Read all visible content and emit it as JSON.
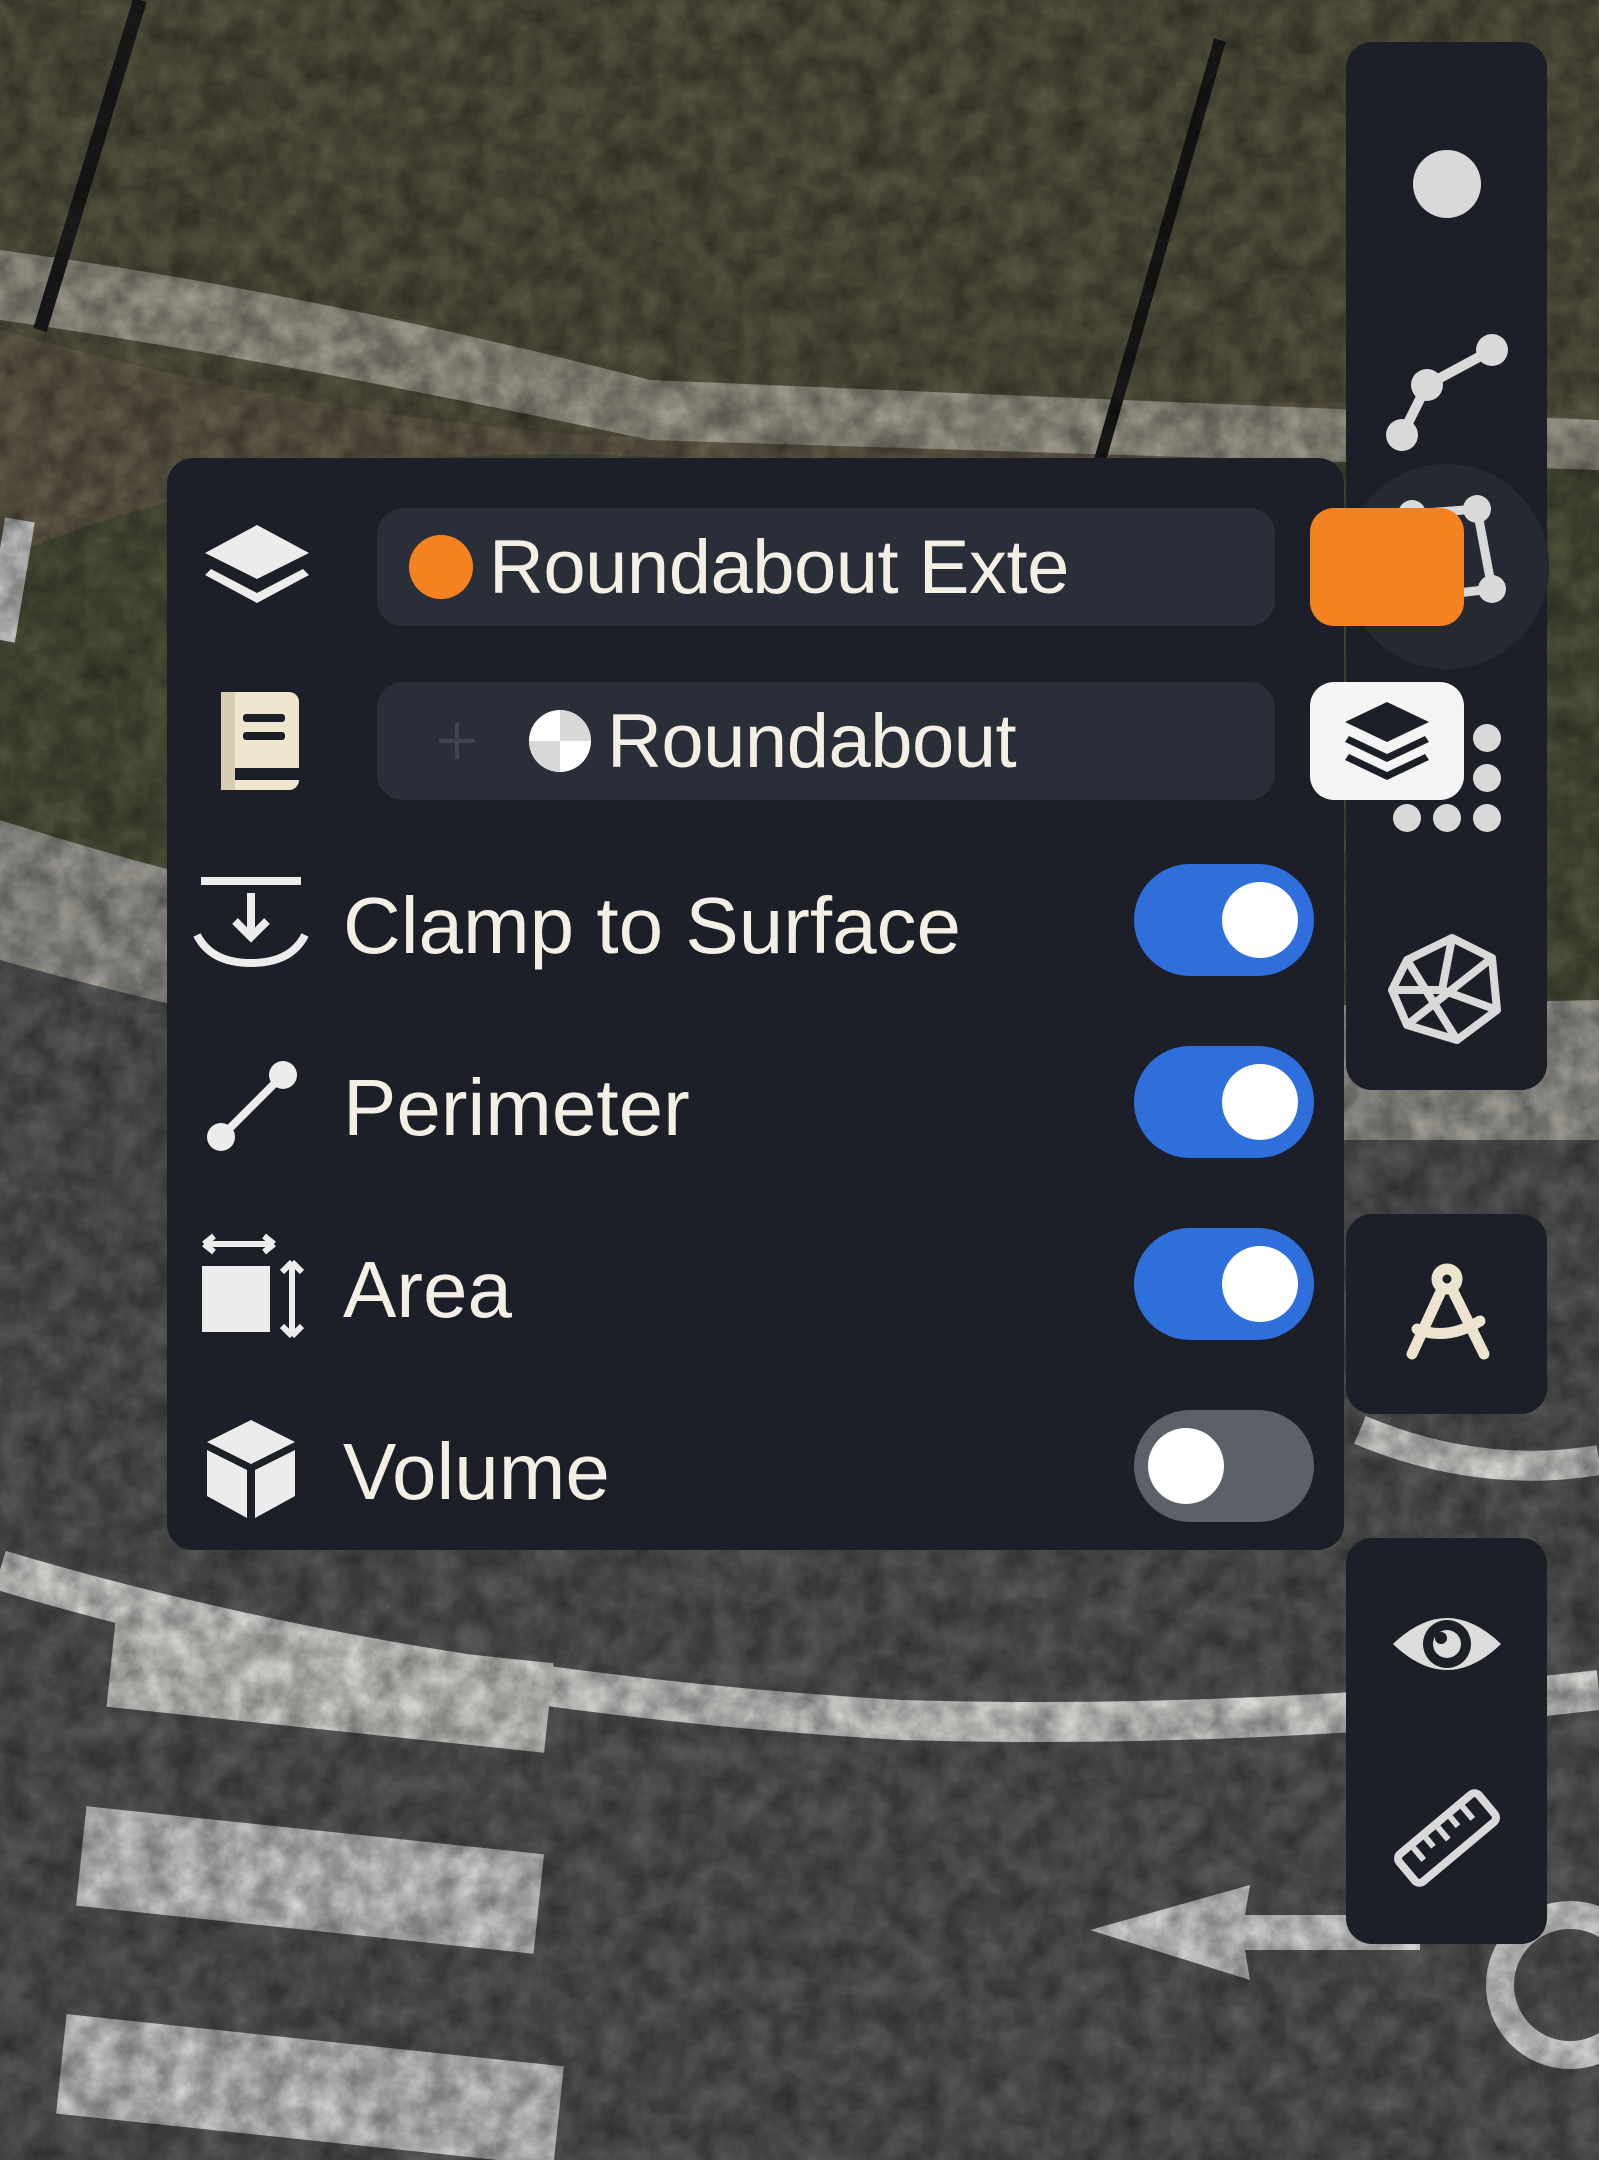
{
  "map": {
    "name": "aerial-imagery"
  },
  "tool_rail": {
    "draw_tools": [
      {
        "name": "point-tool",
        "icon": "point-icon",
        "active": false
      },
      {
        "name": "polyline-tool",
        "icon": "polyline-icon",
        "active": false
      },
      {
        "name": "polygon-tool",
        "icon": "polygon-icon",
        "active": true
      },
      {
        "name": "grid-tool",
        "icon": "grid-dots-icon",
        "active": false
      },
      {
        "name": "mesh-tool",
        "icon": "mesh-icon",
        "active": false
      }
    ],
    "measure_tool": {
      "icon": "compass-icon"
    },
    "view_tools": [
      {
        "icon": "eye-icon"
      },
      {
        "icon": "ruler-icon"
      }
    ]
  },
  "panel": {
    "layer": {
      "icon": "layers-icon",
      "name": "Roundabout Exte",
      "dot_color": "#f58220",
      "swatch_color": "#f58220"
    },
    "style": {
      "icon": "book-icon",
      "name": "Roundabout",
      "swatch_icon": "layers-icon"
    },
    "options": [
      {
        "key": "clamp",
        "icon": "clamp-surface-icon",
        "label": "Clamp to Surface",
        "enabled": true
      },
      {
        "key": "perimeter",
        "icon": "line-segment-icon",
        "label": "Perimeter",
        "enabled": true
      },
      {
        "key": "area",
        "icon": "area-icon",
        "label": "Area",
        "enabled": true
      },
      {
        "key": "volume",
        "icon": "cube-icon",
        "label": "Volume",
        "enabled": false
      }
    ]
  },
  "colors": {
    "panel_bg": "#1c1f27",
    "pill_bg": "#2a2e38",
    "toggle_on": "#2f6fdb",
    "toggle_off": "#5c6068",
    "accent_orange": "#f58220"
  }
}
